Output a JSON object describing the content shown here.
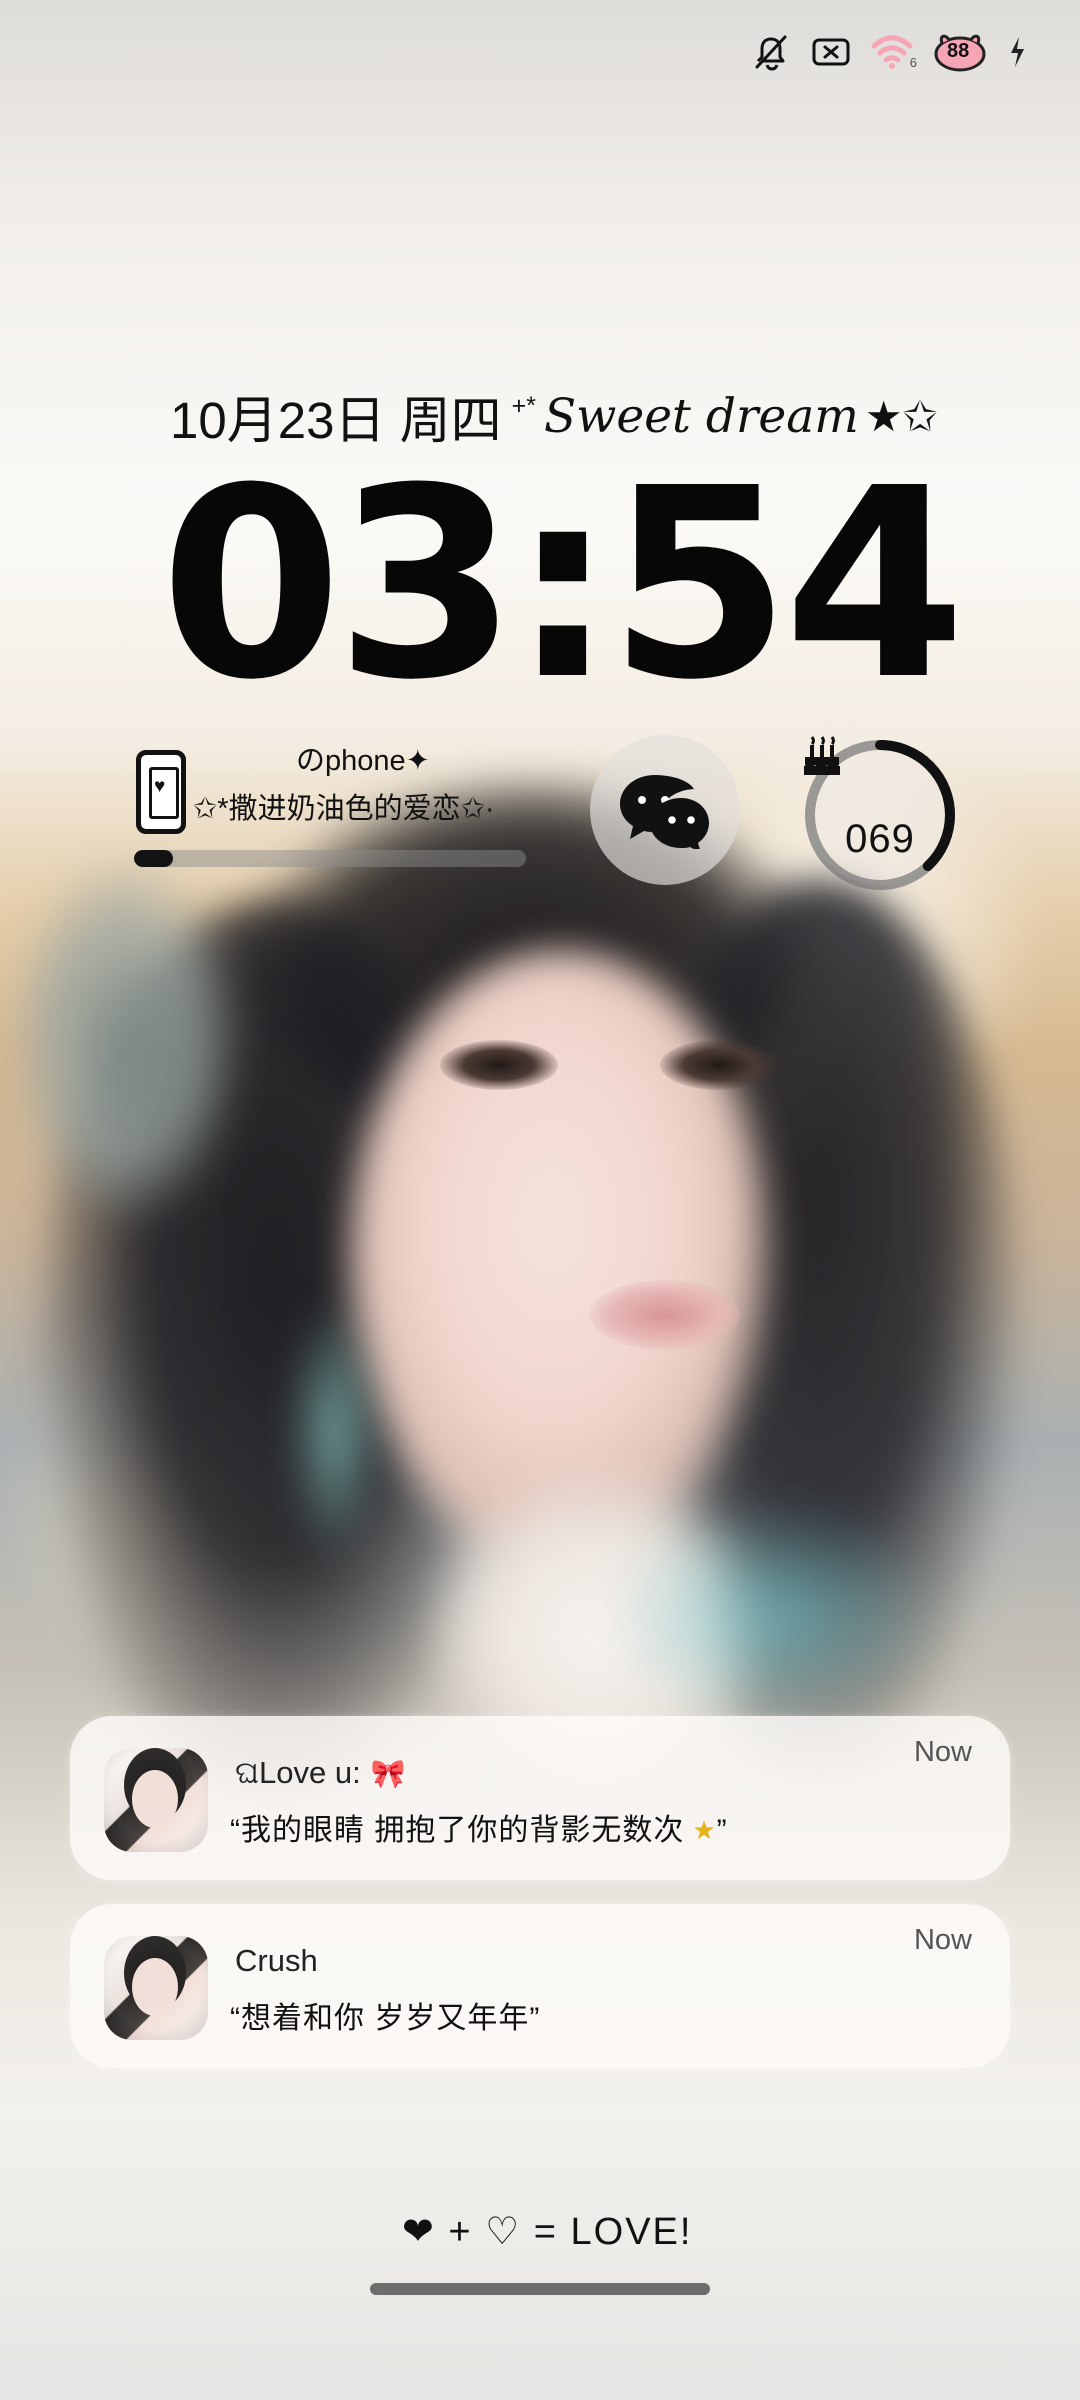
{
  "status_bar": {
    "icons": [
      "silent-bell-icon",
      "sim-blocked-icon",
      "wifi-icon",
      "battery-icon",
      "charging-icon"
    ],
    "wifi_label": "6",
    "battery_level": "88",
    "accent_color": "#f6a5b4"
  },
  "lock_screen": {
    "date": "10月23日 周四",
    "greeting": "Sweet dream",
    "greeting_prefix": "+*",
    "greeting_suffix": "★✩",
    "time": "03:54"
  },
  "widgets": {
    "phone": {
      "title": "のphone✦",
      "subtitle": "✩*撒进奶油色的爱恋✩·",
      "progress": 0.1
    },
    "wechat": {
      "icon": "wechat-icon"
    },
    "birthday": {
      "count": "069",
      "icon": "cake-icon",
      "progress": 0.38
    }
  },
  "notifications": [
    {
      "title": "ଘLove u:",
      "message": "“我的眼睛 拥抱了你的背影无数次",
      "message_end": "”",
      "time": "Now"
    },
    {
      "title": "Crush",
      "message": "“想着和你 岁岁又年年”",
      "time": "Now"
    }
  ],
  "footer": {
    "love_text": "❤ + ♡ = LOVE!"
  }
}
